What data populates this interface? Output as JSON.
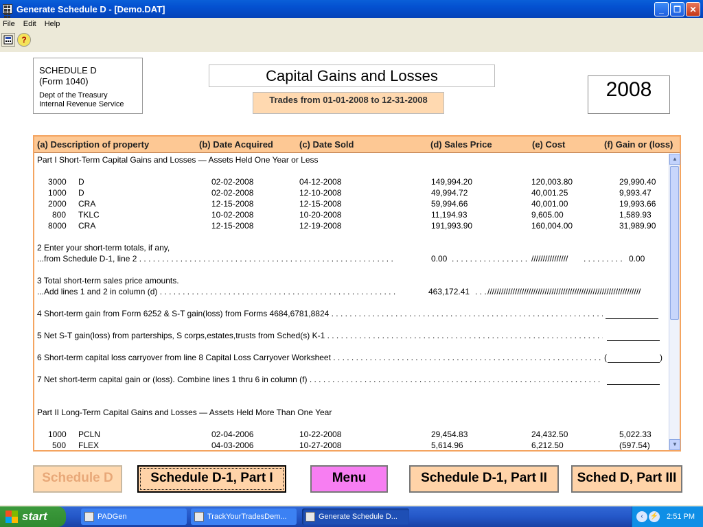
{
  "window": {
    "title": "Generate Schedule D - [Demo.DAT]"
  },
  "menu": [
    "File",
    "Edit",
    "Help"
  ],
  "toolbar": {
    "help_glyph": "?"
  },
  "schedule": {
    "line1": "SCHEDULE D",
    "line2": "(Form 1040)",
    "dept1": "Dept of the Treasury",
    "dept2": "Internal Revenue Service"
  },
  "header": {
    "title": "Capital Gains and Losses",
    "trades": "Trades from 01-01-2008 to 12-31-2008",
    "year": "2008"
  },
  "grid": {
    "columns": [
      "(a) Description of property",
      "(b) Date Acquired",
      "(c) Date Sold",
      "(d) Sales Price",
      "(e) Cost",
      "(f) Gain or (loss)"
    ],
    "part1_heading": "Part I  Short-Term Capital Gains and Losses — Assets Held One Year or Less",
    "part1_rows": [
      {
        "qty": "3000",
        "sym": "D",
        "acq": "02-02-2008",
        "sold": "04-12-2008",
        "price": "149,994.20",
        "cost": "120,003.80",
        "gain": "29,990.40"
      },
      {
        "qty": "1000",
        "sym": "D",
        "acq": "02-02-2008",
        "sold": "12-10-2008",
        "price": "49,994.72",
        "cost": "40,001.25",
        "gain": "9,993.47"
      },
      {
        "qty": "2000",
        "sym": "CRA",
        "acq": "12-15-2008",
        "sold": "12-15-2008",
        "price": "59,994.66",
        "cost": "40,001.00",
        "gain": "19,993.66"
      },
      {
        "qty": "800",
        "sym": "TKLC",
        "acq": "10-02-2008",
        "sold": "10-20-2008",
        "price": "11,194.93",
        "cost": "9,605.00",
        "gain": "1,589.93"
      },
      {
        "qty": "8000",
        "sym": "CRA",
        "acq": "12-15-2008",
        "sold": "12-19-2008",
        "price": "191,993.90",
        "cost": "160,004.00",
        "gain": "31,989.90"
      }
    ],
    "line2a": "2 Enter your short-term totals, if any,",
    "line2b": "...from Schedule D-1, line 2 . . . . . . . . . . . . . . . . . . . . . . . . . . . . . . . . . . . . . . . . . . . . . . . . . . . . . . . .",
    "line2_price": "0.00",
    "line2_dots": ". . . . . . . . . . . . . . . . .",
    "line2_hatch": "////////////////",
    "line2_dots2": ". . . . . . . . . .",
    "line2_gain": "0.00",
    "line3a": "3 Total short-term sales price amounts.",
    "line3b": "...Add lines 1 and 2 in column (d) . . . . . . . . . . . . . . . . . . . . . . . . . . . . . . . . . . . . . . . . . . . . . . . . . . . .",
    "line3_price": "463,172.41",
    "line3_dots": ". . .",
    "line3_hatch": "///////////////////////////////////////////////////////////////////",
    "line4": "4 Short-term gain from Form 6252 & S-T gain(loss) from Forms 4684,6781,8824 . . . . . . . . . . . . . . . . . . . . . . . . . . . . . . . . . . . . . . . . . . . . . . . . . . . . . . . . . . . . . . . . . . . . . .",
    "line5": "5 Net S-T gain(loss) from parterships, S corps,estates,trusts from Sched(s) K-1 . . . . . . . . . . . . . . . . . . . . . . . . . . . . . . . . . . . . . . . . . . . . . . . . . . . . . . . . . . . . . . . . . . . . . .",
    "line6": "6 Short-term capital loss carryover from line 8 Capital Loss Carryover Worksheet . . . . . . . . . . . . . . . . . . . . . . . . . . . . . . . . . . . . . . . . . . . . . . . . . . . . . . . . . . . . . . . . . . . . .",
    "line7": "7 Net short-term capital gain or (loss). Combine lines 1 thru 6 in column (f) . . . . . . . . . . . . . . . . . . . . . . . . . . . . . . . . . . . . . . . . . . . . . . . . . . . . . . . . . . . . . . . . . . . . . . . . . .",
    "part2_heading": "Part II  Long-Term Capital Gains and Losses — Assets Held More Than One Year",
    "part2_rows": [
      {
        "qty": "1000",
        "sym": "PCLN",
        "acq": "02-04-2006",
        "sold": "10-22-2008",
        "price": "29,454.83",
        "cost": "24,432.50",
        "gain": "5,022.33"
      },
      {
        "qty": "500",
        "sym": "FLEX",
        "acq": "04-03-2006",
        "sold": "10-27-2008",
        "price": "5,614.96",
        "cost": "6,212.50",
        "gain": "(597.54)"
      }
    ]
  },
  "buttons": {
    "schedule_d": "Schedule D",
    "d1_part1": "Schedule D-1, Part I",
    "menu": "Menu",
    "d1_part2": "Schedule D-1, Part II",
    "part3": "Sched D, Part III"
  },
  "taskbar": {
    "start": "start",
    "tasks": [
      "PADGen",
      "TrackYourTradesDem...",
      "Generate Schedule D..."
    ],
    "clock": "2:51 PM"
  }
}
